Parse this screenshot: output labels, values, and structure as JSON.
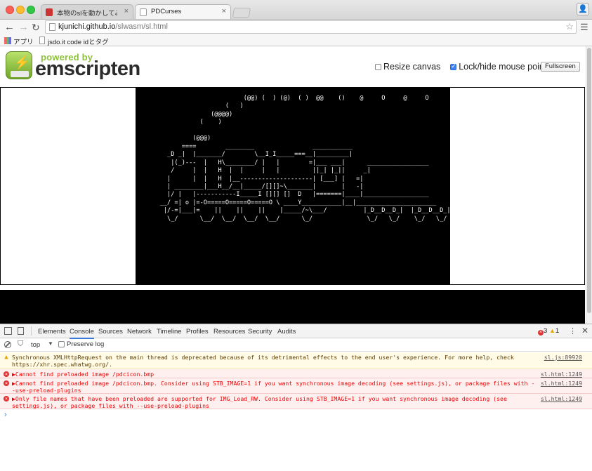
{
  "browser": {
    "tabs": [
      {
        "label": "本物のslを動かしてみた - jsdo",
        "active": false
      },
      {
        "label": "PDCurses",
        "active": true
      }
    ],
    "url_host": "kjunichi.github.io",
    "url_path": "/slwasm/sl.html",
    "bookmarks": [
      {
        "label": "アプリ",
        "icon": "apps-icon"
      },
      {
        "label": "jsdo.it code idとタグ",
        "icon": "page-icon"
      }
    ]
  },
  "page": {
    "logo_powered": "powered by",
    "logo_brand": "emscripten",
    "resize_canvas_label": "Resize canvas",
    "resize_canvas_checked": false,
    "lock_pointer_label": "Lock/hide mouse pointer",
    "lock_pointer_checked": true,
    "fullscreen_label": "Fullscreen",
    "terminal_text": "                           (@@) (  ) (@)  ( )  @@    ()    @     O     @     O\n                      (   )\n                  (@@@@)\n               (    )\n\n             (@@@)\n          ====        ________                ___________\n      _D _|  |_______/        \\__I_I_____===__|_________|\n       |(_)---  |   H\\________/ |   |        =|___ ___|      _________________\n       /     |  |   H  |  |     |   |         ||_| |_||     _|\n      |      |  |   H  |__--------------------| [___] |   =|\n      | ________|___H__/__|_____/[][]~\\_______|       |   -|\n      |/ |   |-----------I_____I [][] []  D   |=======|____|__________________\n    __/ =| o |=-O=====O=====O=====O \\ ____Y___________|__|______________________\n     |/-=|___|=    ||    ||    ||    |_____/~\\___/          |_D__D__D_|  |_D__D__D_|\n      \\_/      \\__/  \\__/  \\__/  \\__/      \\_/               \\_/   \\_/    \\_/   \\_/"
  },
  "devtools": {
    "tabs": [
      "Elements",
      "Console",
      "Sources",
      "Network",
      "Timeline",
      "Profiles",
      "Resources",
      "Security",
      "Audits"
    ],
    "active_tab": "Console",
    "error_count": "3",
    "warning_count": "1",
    "context": "top",
    "preserve_log_label": "Preserve log",
    "messages": [
      {
        "level": "warning",
        "text": "Synchronous XMLHttpRequest on the main thread is deprecated because of its detrimental effects to the end user's experience. For more help, check https://xhr.spec.whatwg.org/.",
        "source": "sl.js:89920"
      },
      {
        "level": "error",
        "text": "▶Cannot find preloaded image /pdcicon.bmp",
        "source": "sl.html:1249"
      },
      {
        "level": "error",
        "text": "▶Cannot find preloaded image /pdcicon.bmp. Consider using STB_IMAGE=1 if you want synchronous image decoding (see settings.js), or package files with --use-preload-plugins",
        "source": "sl.html:1249"
      },
      {
        "level": "error",
        "text": "▶Only file names that have been preloaded are supported for IMG_Load_RW. Consider using STB_IMAGE=1 if you want synchronous image decoding (see settings.js), or package files with --use-preload-plugins",
        "source": "sl.html:1249"
      }
    ],
    "prompt": "›"
  }
}
